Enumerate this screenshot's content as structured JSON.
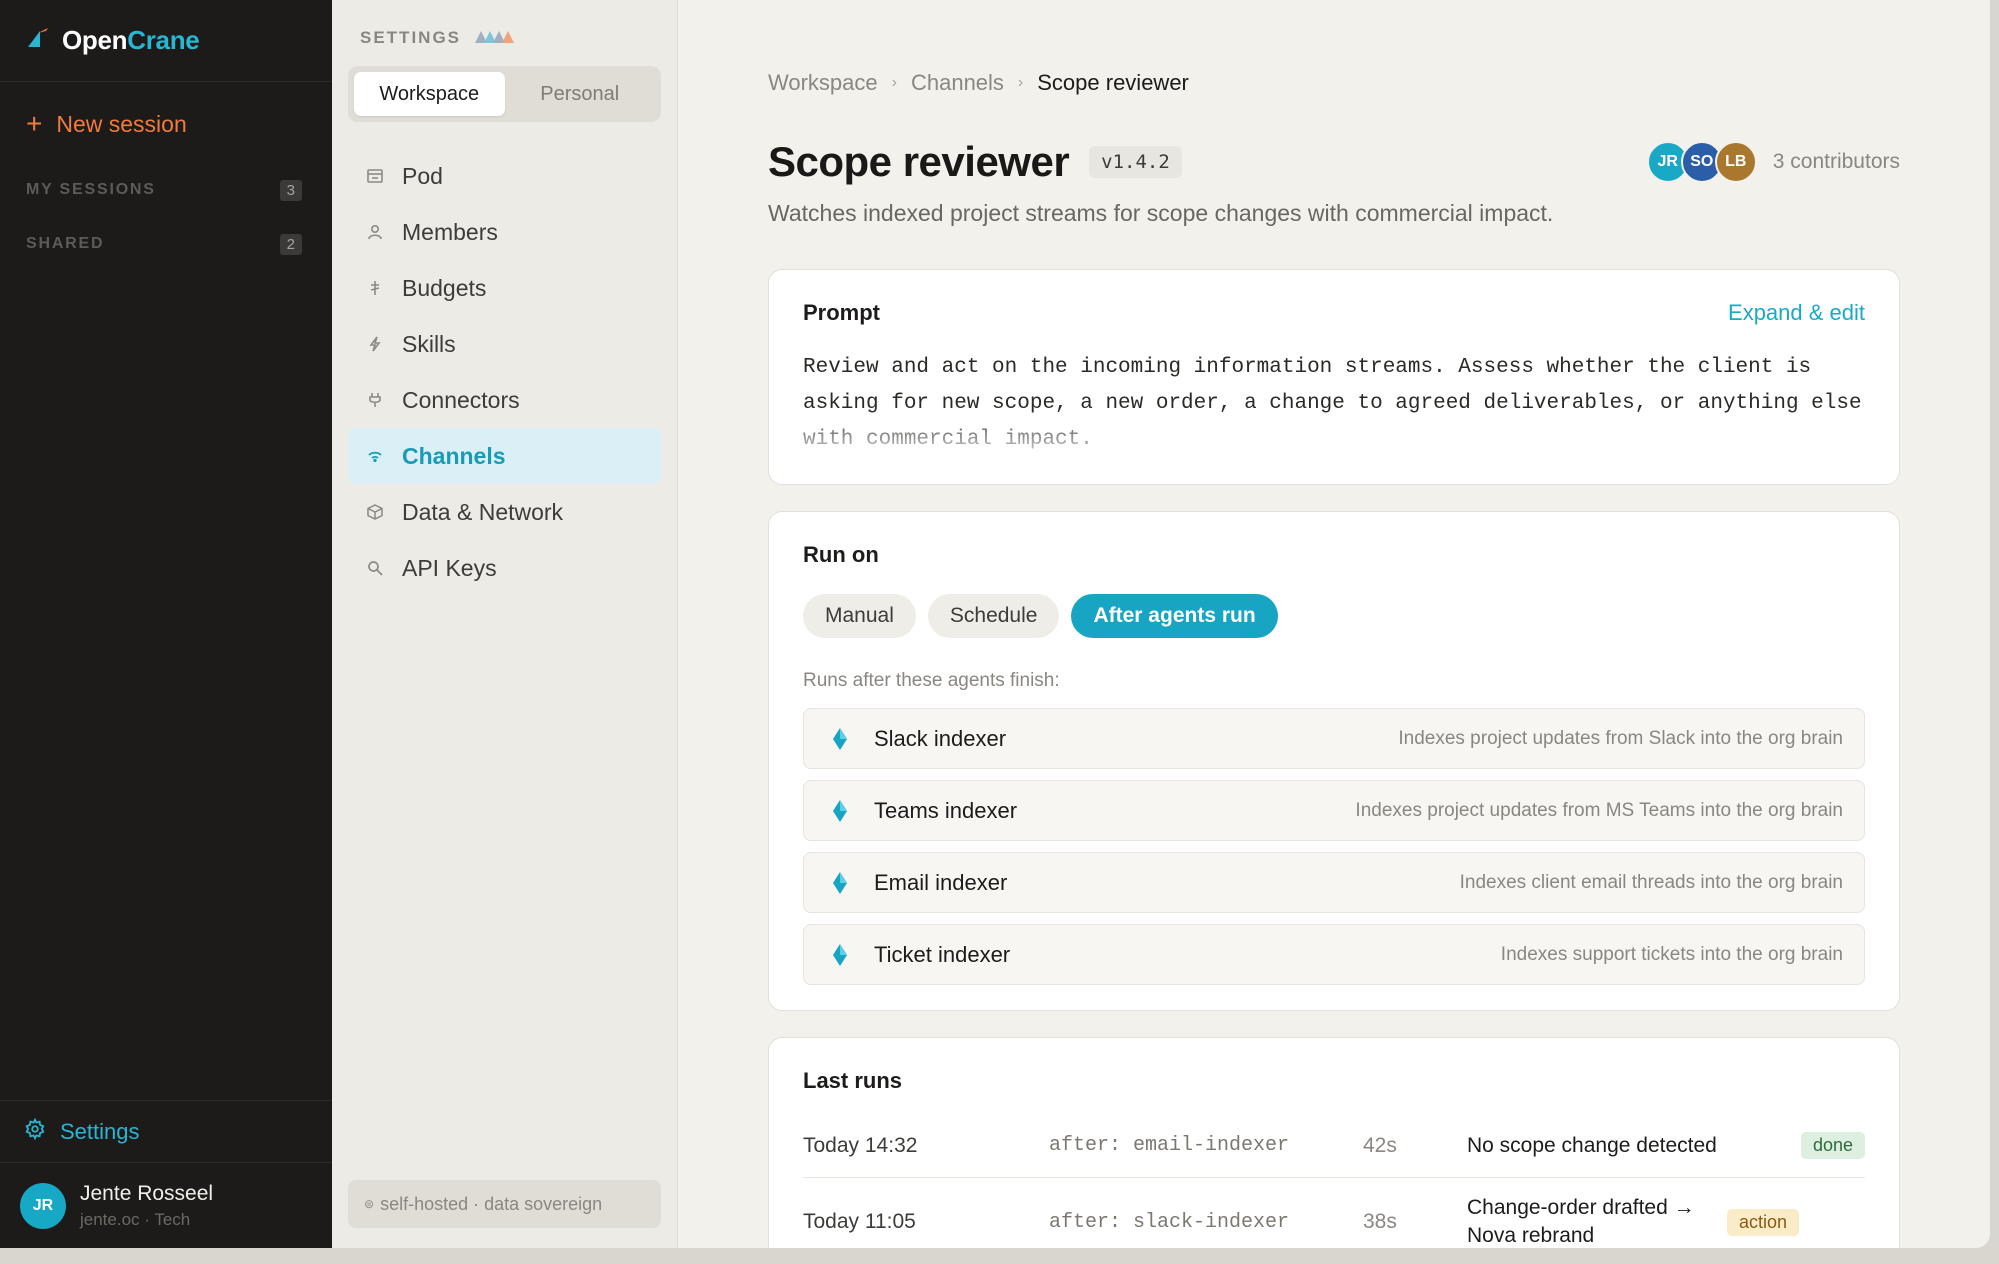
{
  "app": {
    "brand_part1": "Open",
    "brand_part2": "Crane",
    "accent_color": "#17a5c3",
    "orange_color": "#f07b3d"
  },
  "sidebar": {
    "new_session_label": "New session",
    "sections": [
      {
        "label": "MY SESSIONS",
        "count": "3"
      },
      {
        "label": "SHARED",
        "count": "2"
      }
    ],
    "settings_label": "Settings",
    "user": {
      "initials": "JR",
      "name": "Jente Rosseel",
      "subtitle": "jente.oc · Tech"
    }
  },
  "settings_panel": {
    "title": "SETTINGS",
    "tabs": [
      {
        "label": "Workspace",
        "active": true
      },
      {
        "label": "Personal",
        "active": false
      }
    ],
    "menu": [
      {
        "label": "Pod",
        "icon": "pod-icon"
      },
      {
        "label": "Members",
        "icon": "person-icon"
      },
      {
        "label": "Budgets",
        "icon": "currency-icon"
      },
      {
        "label": "Skills",
        "icon": "bolt-icon"
      },
      {
        "label": "Connectors",
        "icon": "plug-icon"
      },
      {
        "label": "Channels",
        "icon": "wifi-icon",
        "active": true
      },
      {
        "label": "Data & Network",
        "icon": "cube-icon"
      },
      {
        "label": "API Keys",
        "icon": "search-icon"
      }
    ],
    "footer": "self-hosted · data sovereign"
  },
  "main": {
    "breadcrumb": [
      "Workspace",
      "Channels",
      "Scope reviewer"
    ],
    "title": "Scope reviewer",
    "version": "v1.4.2",
    "contributors": [
      {
        "initials": "JR",
        "color": "#19a9c6"
      },
      {
        "initials": "SO",
        "color": "#2a5ea8"
      },
      {
        "initials": "LB",
        "color": "#a9772e"
      }
    ],
    "contributors_label": "3 contributors",
    "subtitle": "Watches indexed project streams for scope changes with commercial impact.",
    "prompt": {
      "title": "Prompt",
      "action": "Expand & edit",
      "text": "Review and act on the incoming information streams. Assess whether the client is asking for new scope, a new order, a change to agreed deliverables, or anything else with commercial impact."
    },
    "run_on": {
      "title": "Run on",
      "options": [
        {
          "label": "Manual",
          "active": false
        },
        {
          "label": "Schedule",
          "active": false
        },
        {
          "label": "After agents run",
          "active": true
        }
      ],
      "agents_label": "Runs after these agents finish:",
      "agents": [
        {
          "name": "Slack indexer",
          "desc": "Indexes project updates from Slack into the org brain"
        },
        {
          "name": "Teams indexer",
          "desc": "Indexes project updates from MS Teams into the org brain"
        },
        {
          "name": "Email indexer",
          "desc": "Indexes client email threads into the org brain"
        },
        {
          "name": "Ticket indexer",
          "desc": "Indexes support tickets into the org brain"
        }
      ]
    },
    "last_runs": {
      "title": "Last runs",
      "rows": [
        {
          "time": "Today 14:32",
          "trigger": "after: email-indexer",
          "duration": "42s",
          "result": "No scope change detected",
          "status": "done"
        },
        {
          "time": "Today 11:05",
          "trigger": "after: slack-indexer",
          "duration": "38s",
          "result": "Change-order drafted → Nova rebrand",
          "status": "action"
        }
      ]
    }
  }
}
